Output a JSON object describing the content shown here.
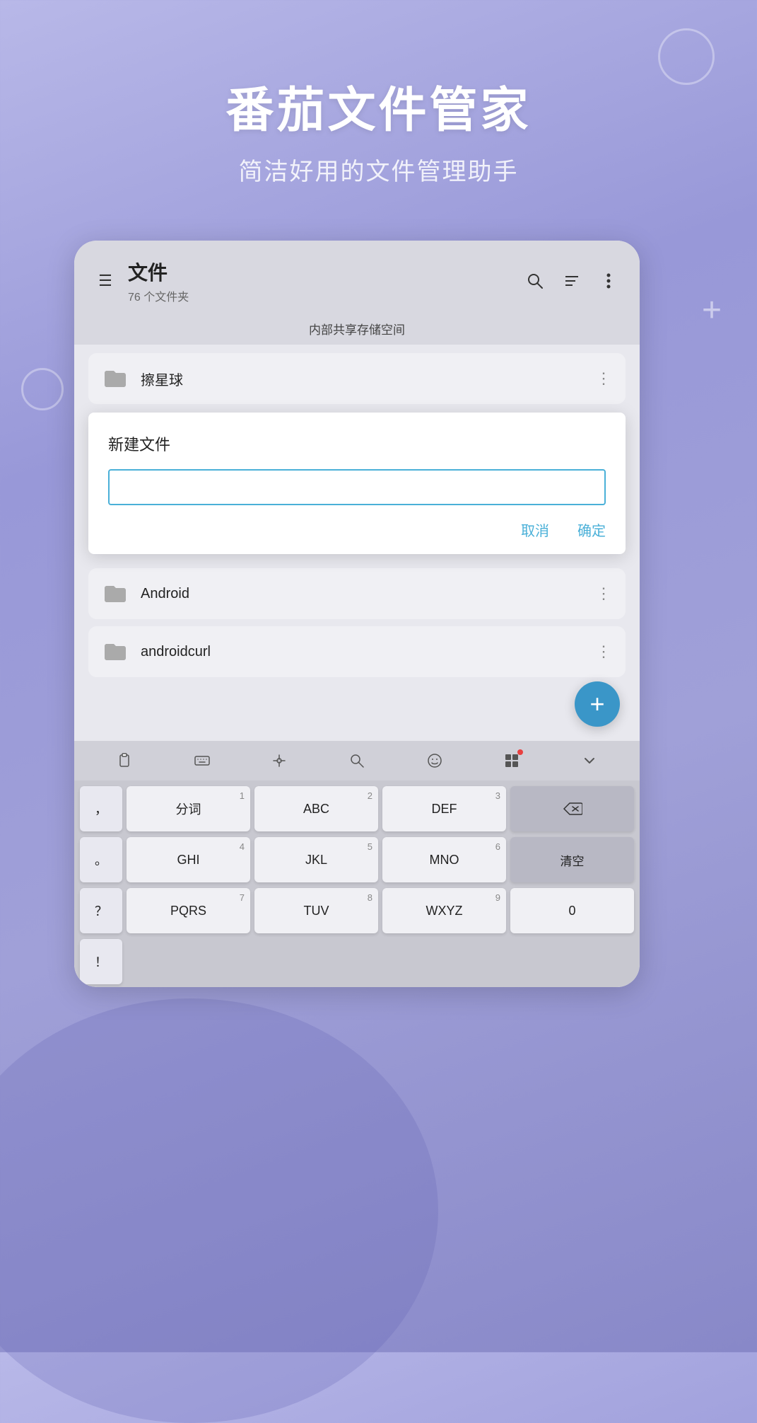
{
  "header": {
    "main_title": "番茄文件管家",
    "sub_title": "简洁好用的文件管理助手"
  },
  "app": {
    "toolbar": {
      "title": "文件",
      "subtitle": "76 个文件夹",
      "hamburger_icon": "☰",
      "search_icon": "🔍",
      "sort_icon": "≡",
      "more_icon": "⋮"
    },
    "storage_label": "内部共享存储空间",
    "files": [
      {
        "name": "擦星球",
        "more": "⋮"
      },
      {
        "name": "",
        "more": "⋮",
        "dimmed": true
      },
      {
        "name": "",
        "more": "⋮",
        "dimmed": true
      },
      {
        "name": "Android",
        "more": "⋮"
      },
      {
        "name": "androidcurl",
        "more": "⋮"
      }
    ],
    "dialog": {
      "title": "新建文件",
      "input_placeholder": "",
      "cancel_label": "取消",
      "confirm_label": "确定"
    },
    "fab": "+"
  },
  "keyboard": {
    "toolbar_icons": [
      "clipboard",
      "keyboard",
      "cursor",
      "search",
      "emoji",
      "grid",
      "chevron-down"
    ],
    "rows": [
      {
        "keys": [
          {
            "symbol": "，",
            "num": ""
          },
          {
            "label": "分词",
            "num": "1",
            "sub": ""
          },
          {
            "label": "ABC",
            "num": "2",
            "sub": ""
          },
          {
            "label": "DEF",
            "num": "3",
            "sub": ""
          },
          {
            "label": "⌫",
            "special": true
          }
        ]
      },
      {
        "keys": [
          {
            "symbol": "。",
            "num": ""
          },
          {
            "label": "GHI",
            "num": "4",
            "sub": ""
          },
          {
            "label": "JKL",
            "num": "5",
            "sub": ""
          },
          {
            "label": "MNO",
            "num": "6",
            "sub": ""
          },
          {
            "label": "清空",
            "special": true
          }
        ]
      },
      {
        "keys": [
          {
            "symbol": "？",
            "num": ""
          },
          {
            "label": "PQRS",
            "num": "7",
            "sub": ""
          },
          {
            "label": "TUV",
            "num": "8",
            "sub": ""
          },
          {
            "label": "WXYZ",
            "num": "9",
            "sub": ""
          },
          {
            "symbol": "0",
            "num": ""
          }
        ]
      },
      {
        "keys": [
          {
            "symbol": "！",
            "num": ""
          }
        ]
      }
    ]
  }
}
